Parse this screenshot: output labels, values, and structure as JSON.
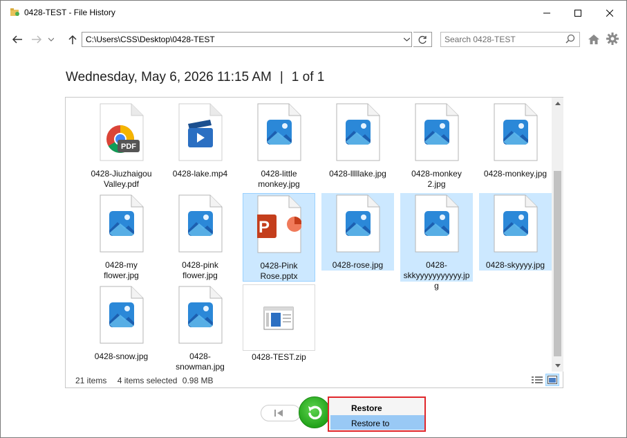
{
  "window": {
    "title": "0428-TEST - File History"
  },
  "toolbar": {
    "address": "C:\\Users\\CSS\\Desktop\\0428-TEST",
    "search_placeholder": "Search 0428-TEST"
  },
  "header": {
    "date": "Wednesday, May 6, 2026 11:15 AM",
    "separator": "|",
    "page": "1 of 1"
  },
  "files": [
    {
      "label": "0428-Jiuzhaigou Valley.pdf",
      "icon": "pdf-icon",
      "selected": false
    },
    {
      "label": "0428-lake.mp4",
      "icon": "video-icon",
      "selected": false
    },
    {
      "label": "0428-little monkey.jpg",
      "icon": "image-icon",
      "selected": false
    },
    {
      "label": "0428-lllllake.jpg",
      "icon": "image-icon",
      "selected": false
    },
    {
      "label": "0428-monkey 2.jpg",
      "icon": "image-icon",
      "selected": false
    },
    {
      "label": "0428-monkey.jpg",
      "icon": "image-icon",
      "selected": false
    },
    {
      "label": "0428-my flower.jpg",
      "icon": "image-icon",
      "selected": false
    },
    {
      "label": "0428-pink flower.jpg",
      "icon": "image-icon",
      "selected": false
    },
    {
      "label": "0428-Pink Rose.pptx",
      "icon": "powerpoint-icon",
      "selected": true
    },
    {
      "label": "0428-rose.jpg",
      "icon": "image-icon",
      "selected": true
    },
    {
      "label": "0428-skkyyyyyyyyyyy.jpg",
      "icon": "image-icon",
      "selected": true
    },
    {
      "label": "0428-skyyyy.jpg",
      "icon": "image-icon",
      "selected": true
    },
    {
      "label": "0428-snow.jpg",
      "icon": "image-icon",
      "selected": false
    },
    {
      "label": "0428-snowman.jpg",
      "icon": "image-icon",
      "selected": false
    },
    {
      "label": "0428-TEST.zip",
      "icon": "zip-icon",
      "selected": false
    }
  ],
  "status": {
    "item_count": "21 items",
    "selection": "4 items selected",
    "size": "0.98 MB"
  },
  "menu": {
    "restore": "Restore",
    "restore_to": "Restore to"
  },
  "colors": {
    "selection": "#cce8ff",
    "restore_green": "#22a31a",
    "highlight_box": "#e0262b",
    "menu_hover": "#99c9f5"
  }
}
